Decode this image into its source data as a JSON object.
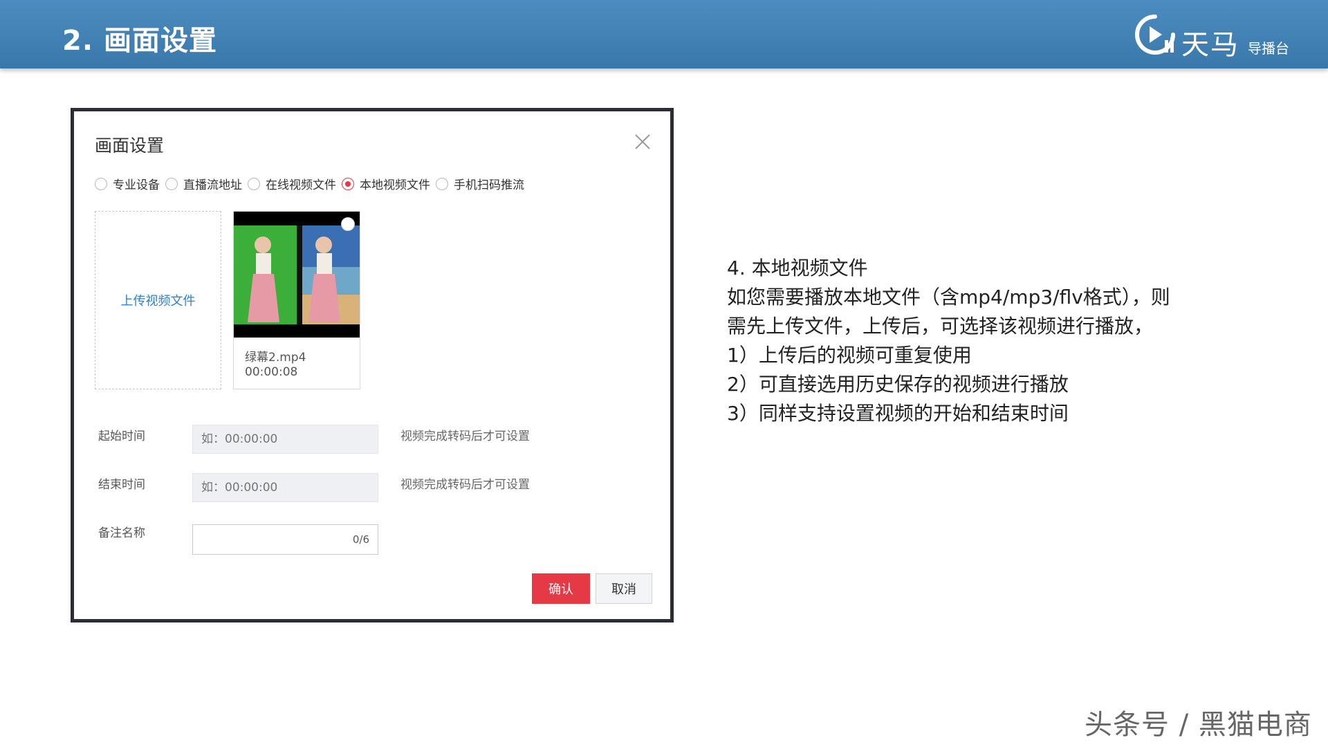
{
  "header": {
    "title": "2. 画面设置",
    "brand_name": "天马",
    "brand_sub": "导播台"
  },
  "dialog": {
    "title": "画面设置",
    "source_options": [
      {
        "label": "专业设备",
        "checked": false
      },
      {
        "label": "直播流地址",
        "checked": false
      },
      {
        "label": "在线视频文件",
        "checked": false
      },
      {
        "label": "本地视频文件",
        "checked": true
      },
      {
        "label": "手机扫码推流",
        "checked": false
      }
    ],
    "upload_label": "上传视频文件",
    "video": {
      "name": "绿幕2.mp4",
      "duration": "00:00:08"
    },
    "start_time": {
      "label": "起始时间",
      "placeholder": "如：00:00:00",
      "hint": "视频完成转码后才可设置"
    },
    "end_time": {
      "label": "结束时间",
      "placeholder": "如：00:00:00",
      "hint": "视频完成转码后才可设置"
    },
    "remark": {
      "label": "备注名称",
      "value": "",
      "counter": "0/6"
    },
    "confirm_label": "确认",
    "cancel_label": "取消",
    "colors": {
      "accent": "#e53945",
      "link": "#2f80d0"
    }
  },
  "notes": [
    "4. 本地视频文件",
    "如您需要播放本地文件（含mp4/mp3/flv格式），则",
    "需先上传文件，上传后，可选择该视频进行播放，",
    "1）上传后的视频可重复使用",
    "2）可直接选用历史保存的视频进行播放",
    "3）同样支持设置视频的开始和结束时间"
  ],
  "watermark": "头条号 / 黑猫电商"
}
